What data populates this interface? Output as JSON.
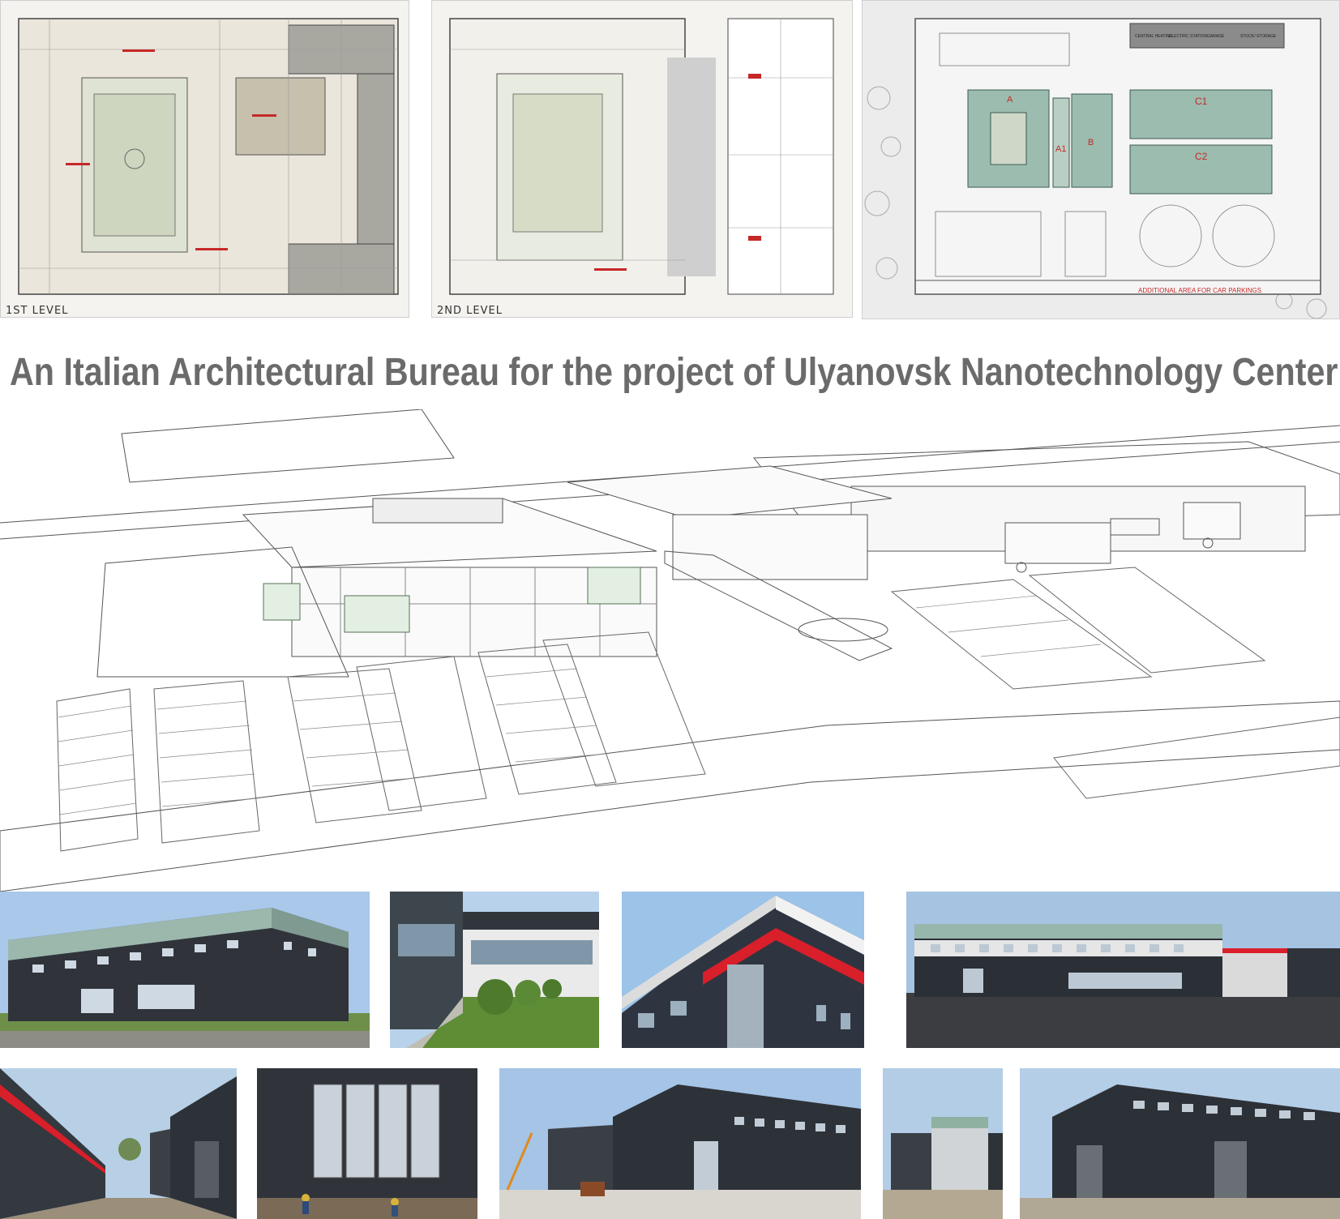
{
  "header": {
    "title": "An Italian Architectural Bureau for the project of Ulyanovsk Nanotechnology Center"
  },
  "plans": {
    "level1_label": "1ST LEVEL",
    "level2_label": "2ND LEVEL",
    "site_plan": {
      "building_a": "A",
      "building_a1": "A1",
      "building_b": "B",
      "building_c1": "C1",
      "building_c2": "C2",
      "additional_area": "ADDITIONAL AREA FOR CAR PARKINGS",
      "service_labels": [
        "CENTRAL HEATING",
        "ELECTRIC STATION",
        "GARAGE",
        "STOCK/ STORAGE"
      ]
    }
  },
  "colors": {
    "title_gray": "#6b6b6b",
    "roof_green": "#8fb1a2",
    "facade_dark": "#2b2f36",
    "accent_red": "#d81f2a",
    "sky_blue": "#9cc3e8",
    "grass_green": "#5f8f3a"
  }
}
